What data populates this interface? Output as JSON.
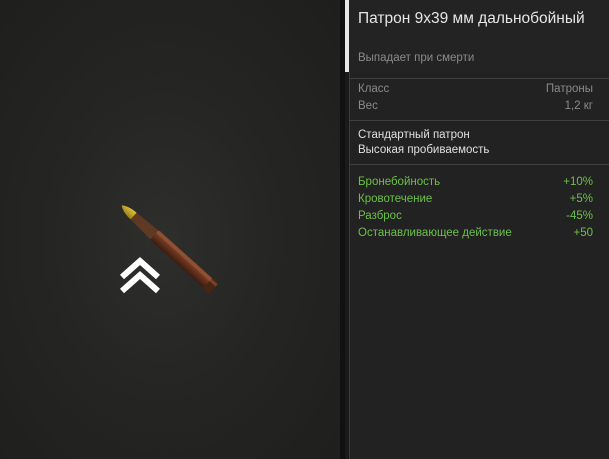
{
  "item": {
    "title": "Патрон 9х39 мм дальнобойный",
    "subtitle": "Выпадает при смерти"
  },
  "meta": [
    {
      "label": "Класс",
      "value": "Патроны"
    },
    {
      "label": "Вес",
      "value": "1,2 кг"
    }
  ],
  "description": [
    "Стандартный патрон",
    "Высокая пробиваемость"
  ],
  "stats": [
    {
      "label": "Бронебойность",
      "value": "+10%"
    },
    {
      "label": "Кровотечение",
      "value": "+5%"
    },
    {
      "label": "Разброс",
      "value": "-45%"
    },
    {
      "label": "Останавливающее действие",
      "value": "+50"
    }
  ],
  "icons": {
    "item_image": "rifle-cartridge-icon",
    "rank": "double-chevron-up-icon"
  },
  "colors": {
    "stat_positive": "#6cc04a",
    "meta_text": "#8a8a8a",
    "primary_text": "#e6e6e6",
    "accent": "#e8e8e8"
  }
}
